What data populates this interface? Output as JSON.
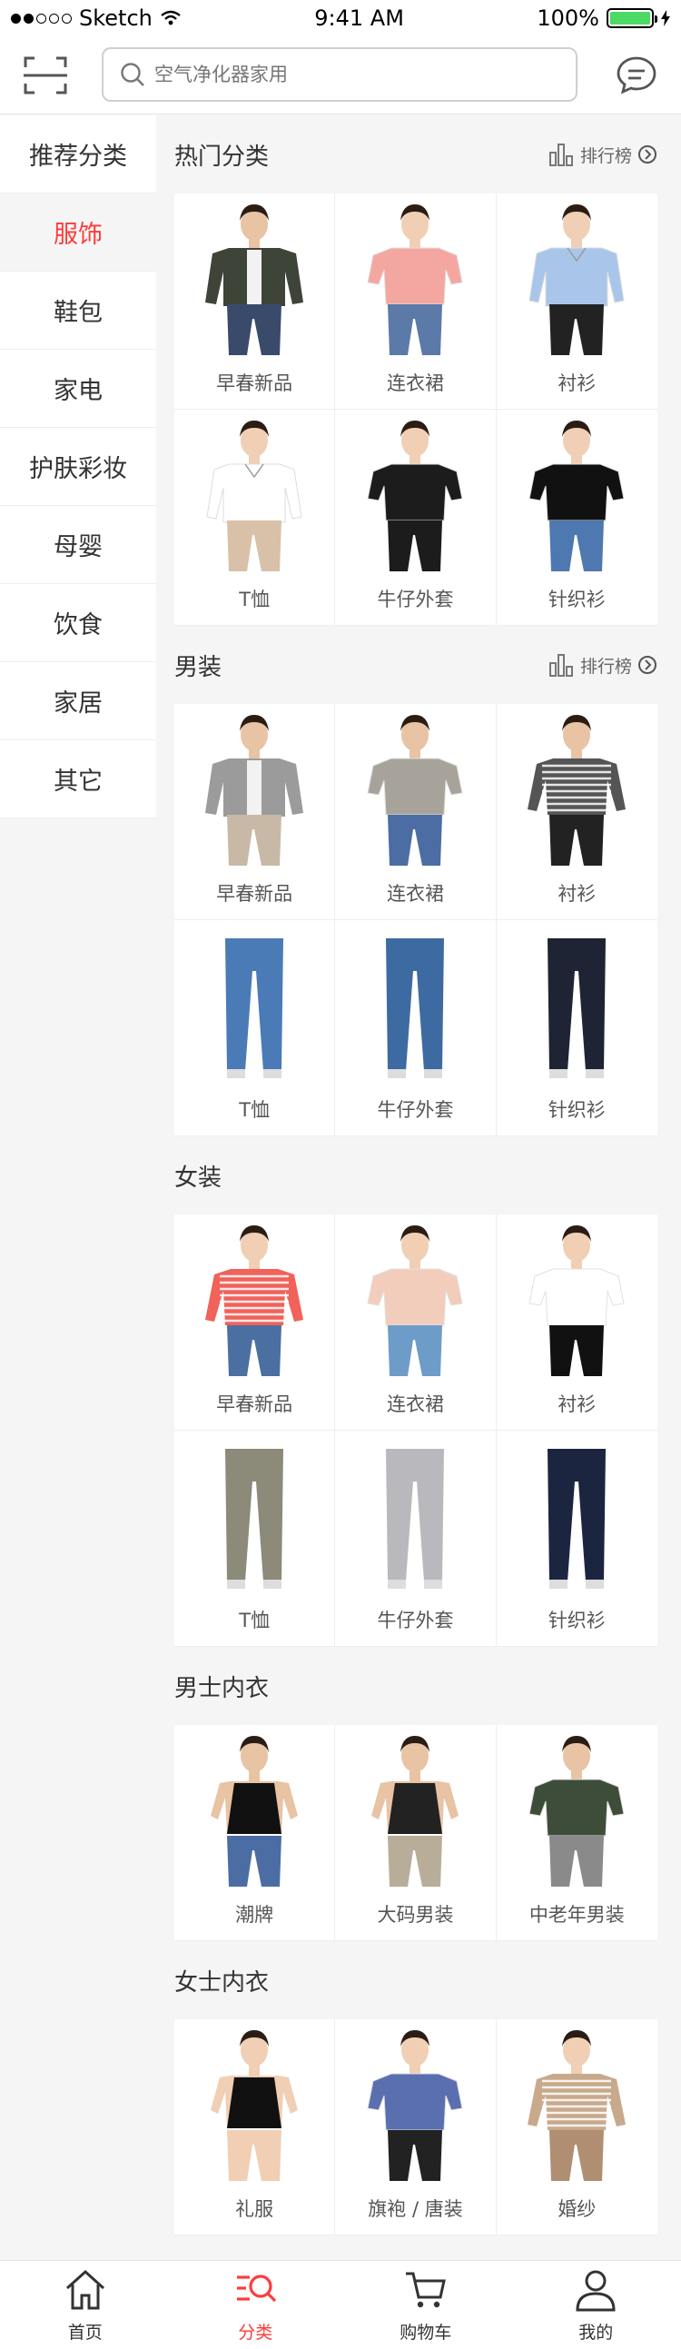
{
  "status_bar": {
    "carrier": "Sketch",
    "time": "9:41 AM",
    "battery": "100%"
  },
  "search": {
    "placeholder": "空气净化器家用"
  },
  "sidebar": {
    "items": [
      {
        "label": "推荐分类"
      },
      {
        "label": "服饰"
      },
      {
        "label": "鞋包"
      },
      {
        "label": "家电"
      },
      {
        "label": "护肤彩妆"
      },
      {
        "label": "母婴"
      },
      {
        "label": "饮食"
      },
      {
        "label": "家居"
      },
      {
        "label": "其它"
      }
    ],
    "active_index": 1
  },
  "sections": [
    {
      "title": "热门分类",
      "rank_label": "排行榜",
      "items": [
        {
          "label": "早春新品",
          "kind": "jacket",
          "top": "#3f4438",
          "bottom": "#3a4a6b",
          "skin": "#e8c3a4"
        },
        {
          "label": "连衣裙",
          "kind": "hoodie",
          "top": "#f4a7a0",
          "bottom": "#5b7aa8",
          "skin": "#f0cfb5"
        },
        {
          "label": "衬衫",
          "kind": "shirt",
          "top": "#a9c6ea",
          "bottom": "#222222",
          "skin": "#f0cfb5"
        },
        {
          "label": "T恤",
          "kind": "blouse",
          "top": "#ffffff",
          "bottom": "#d8c1a8",
          "skin": "#f0cfb5"
        },
        {
          "label": "牛仔外套",
          "kind": "track",
          "top": "#1c1c1c",
          "bottom": "#1c1c1c",
          "skin": "#f0cfb5"
        },
        {
          "label": "针织衫",
          "kind": "sweater",
          "top": "#111111",
          "bottom": "#4e78b0",
          "skin": "#f0cfb5"
        }
      ]
    },
    {
      "title": "男装",
      "rank_label": "排行榜",
      "items": [
        {
          "label": "早春新品",
          "kind": "jacket",
          "top": "#9b9b9b",
          "bottom": "#c7b9a6",
          "skin": "#e8c3a4"
        },
        {
          "label": "连衣裙",
          "kind": "tee",
          "top": "#a8a39a",
          "bottom": "#4c6da3",
          "skin": "#e8c3a4"
        },
        {
          "label": "衬衫",
          "kind": "stripe",
          "top": "#555555",
          "bottom": "#222222",
          "skin": "#e8c3a4"
        },
        {
          "label": "T恤",
          "kind": "jeans",
          "top": "#ffffff",
          "bottom": "#4a7bb6",
          "skin": "#e8c3a4"
        },
        {
          "label": "牛仔外套",
          "kind": "jeans",
          "top": "#ffffff",
          "bottom": "#3e6aa2",
          "skin": "#e8c3a4"
        },
        {
          "label": "针织衫",
          "kind": "jeans",
          "top": "#ffffff",
          "bottom": "#1e2433",
          "skin": "#e8c3a4"
        }
      ]
    },
    {
      "title": "女装",
      "rank_label": "",
      "items": [
        {
          "label": "早春新品",
          "kind": "stripe",
          "top": "#f0625a",
          "bottom": "#4b6fa0",
          "skin": "#f0cfb5"
        },
        {
          "label": "连衣裙",
          "kind": "tee",
          "top": "#f3cdbb",
          "bottom": "#6e9cc8",
          "skin": "#f0cfb5"
        },
        {
          "label": "衬衫",
          "kind": "tee",
          "top": "#ffffff",
          "bottom": "#111111",
          "skin": "#f0cfb5"
        },
        {
          "label": "T恤",
          "kind": "jeans",
          "top": "#ffffff",
          "bottom": "#8c8a78",
          "skin": "#f0cfb5"
        },
        {
          "label": "牛仔外套",
          "kind": "jeans",
          "top": "#ffffff",
          "bottom": "#b9b9bd",
          "skin": "#f0cfb5"
        },
        {
          "label": "针织衫",
          "kind": "jeans",
          "top": "#1c2540",
          "bottom": "#1c2540",
          "skin": "#f0cfb5"
        }
      ]
    },
    {
      "title": "男士内衣",
      "rank_label": "",
      "items": [
        {
          "label": "潮牌",
          "kind": "tank",
          "top": "#111111",
          "bottom": "#4c6da3",
          "skin": "#e8c3a4"
        },
        {
          "label": "大码男装",
          "kind": "tank",
          "top": "#222222",
          "bottom": "#b8ad98",
          "skin": "#e8c3a4"
        },
        {
          "label": "中老年男装",
          "kind": "tee",
          "top": "#3e4d3a",
          "bottom": "#8a8a8a",
          "skin": "#e8c3a4"
        }
      ]
    },
    {
      "title": "女士内衣",
      "rank_label": "",
      "items": [
        {
          "label": "礼服",
          "kind": "tank",
          "top": "#111111",
          "bottom": "#f0cfb5",
          "skin": "#f0cfb5"
        },
        {
          "label": "旗袍 / 唐装",
          "kind": "tee",
          "top": "#5a6fb0",
          "bottom": "#222222",
          "skin": "#f0cfb5"
        },
        {
          "label": "婚纱",
          "kind": "stripe",
          "top": "#c9a98c",
          "bottom": "#b08e72",
          "skin": "#f0cfb5"
        }
      ]
    }
  ],
  "tabbar": {
    "items": [
      {
        "label": "首页",
        "icon": "home-icon"
      },
      {
        "label": "分类",
        "icon": "category-icon"
      },
      {
        "label": "购物车",
        "icon": "cart-icon"
      },
      {
        "label": "我的",
        "icon": "profile-icon"
      }
    ],
    "active_index": 1
  },
  "colors": {
    "accent": "#ff3b3b",
    "background": "#f5f5f5",
    "text": "#333333"
  }
}
